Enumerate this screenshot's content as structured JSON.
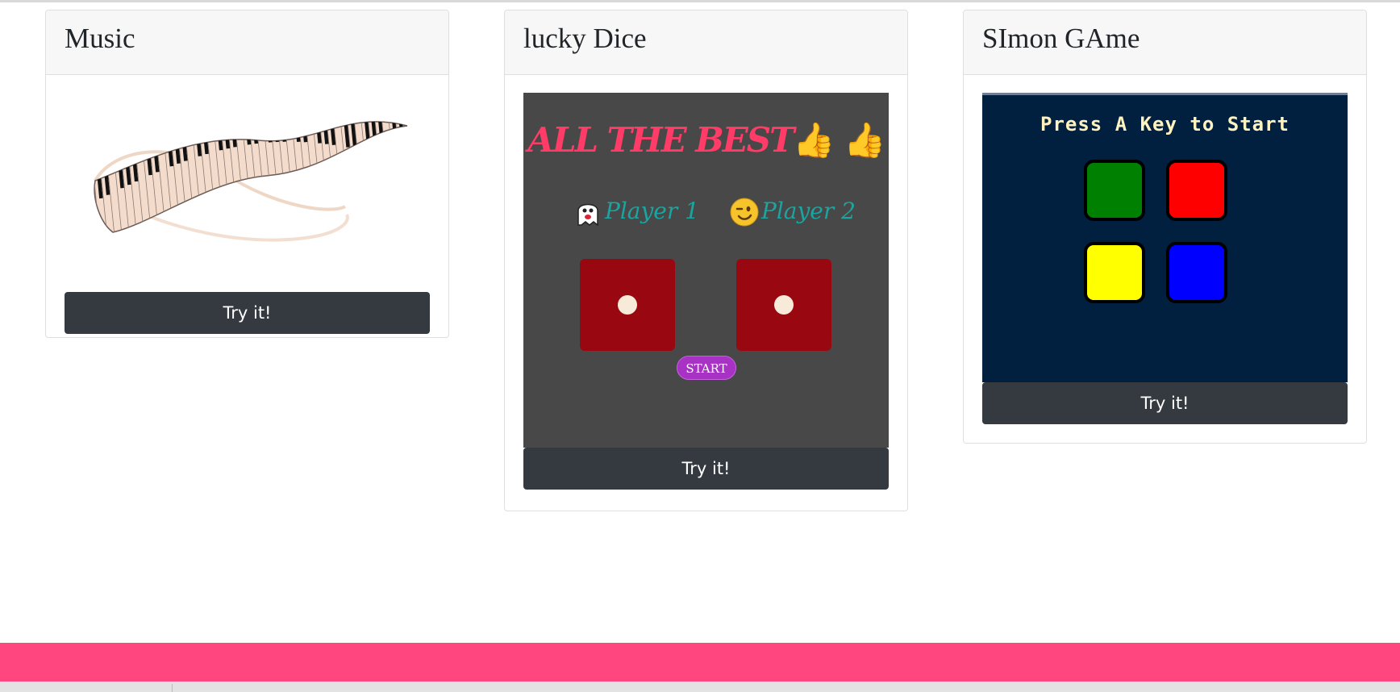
{
  "cards": [
    {
      "title": "Music",
      "button_label": "Try it!",
      "preview": {
        "type": "image",
        "icon": "piano-keyboard-ribbon-icon"
      }
    },
    {
      "title": "lucky Dice",
      "button_label": "Try it!",
      "preview": {
        "type": "game-screenshot",
        "heading": "ALL THE BEST",
        "heading_icons": [
          "thumbs-up-icon",
          "thumbs-up-icon"
        ],
        "players": [
          {
            "label": "Player 1",
            "icon": "ghost-icon"
          },
          {
            "label": "Player 2",
            "icon": "winking-face-icon"
          }
        ],
        "start_label": "START",
        "colors": {
          "background": "#484848",
          "die": "#990810",
          "heading": "#ff3b67",
          "player_text": "#1aa5a0",
          "start": "#a732c4"
        }
      }
    },
    {
      "title": "SImon GAme",
      "button_label": "Try it!",
      "preview": {
        "type": "game-screenshot",
        "heading": "Press A Key to Start",
        "pads": [
          "#008000",
          "#ff0000",
          "#ffff00",
          "#0000ff"
        ],
        "colors": {
          "background": "#011f3f",
          "heading": "#fef2bf"
        }
      }
    }
  ],
  "footer": {
    "color": "#ff467e"
  }
}
